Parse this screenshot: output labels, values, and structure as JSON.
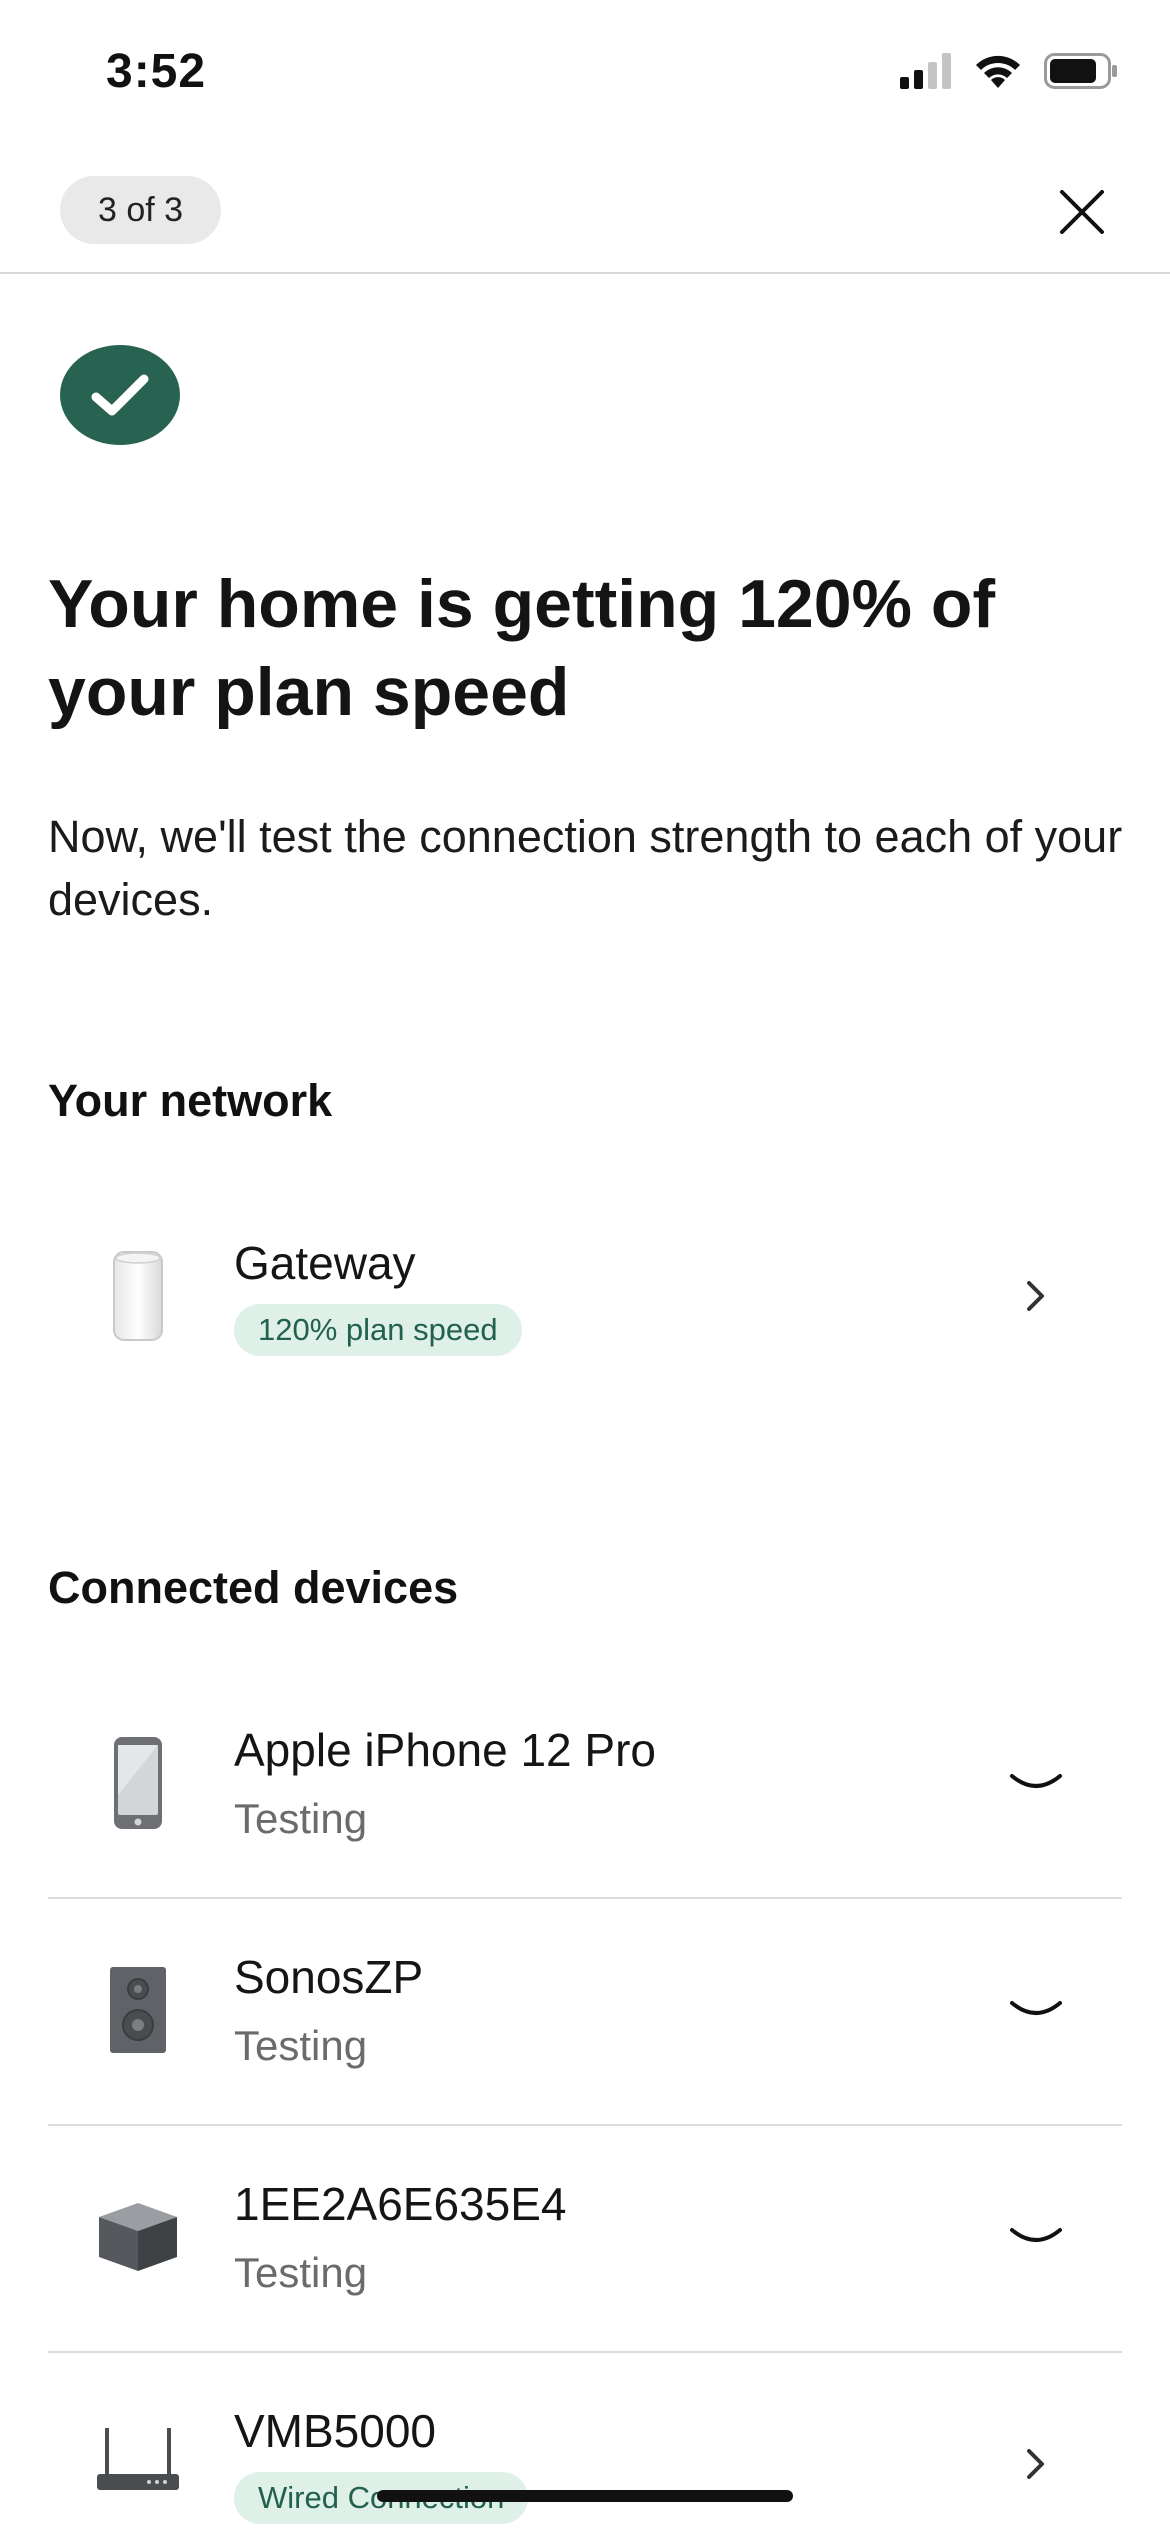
{
  "status_bar": {
    "time": "3:52",
    "icons": [
      "cellular-signal-icon",
      "wifi-icon",
      "battery-icon"
    ]
  },
  "header": {
    "step_label": "3 of 3",
    "close_icon": "close-icon"
  },
  "hero": {
    "badge_icon": "checkmark-icon",
    "badge_color": "#286251",
    "title": "Your home is getting 120% of your plan speed",
    "subtitle": "Now, we'll test the connection strength to each of your devices."
  },
  "network": {
    "heading": "Your network",
    "gateway": {
      "name": "Gateway",
      "tag": "120% plan speed",
      "icon": "gateway-icon",
      "action_icon": "chevron-right-icon"
    }
  },
  "devices": {
    "heading": "Connected devices",
    "items": [
      {
        "name": "Apple iPhone 12 Pro",
        "status": "Testing",
        "icon": "phone-icon",
        "action_icon": "loading-spinner-icon"
      },
      {
        "name": "SonosZP",
        "status": "Testing",
        "icon": "speaker-icon",
        "action_icon": "loading-spinner-icon"
      },
      {
        "name": "1EE2A6E635E4",
        "status": "Testing",
        "icon": "cube-device-icon",
        "action_icon": "loading-spinner-icon"
      },
      {
        "name": "VMB5000",
        "tag": "Wired Connection",
        "icon": "router-icon",
        "action_icon": "chevron-right-icon"
      }
    ]
  },
  "colors": {
    "accent_green": "#286251",
    "tag_background": "#dff0e8",
    "tag_text": "#22624c"
  }
}
